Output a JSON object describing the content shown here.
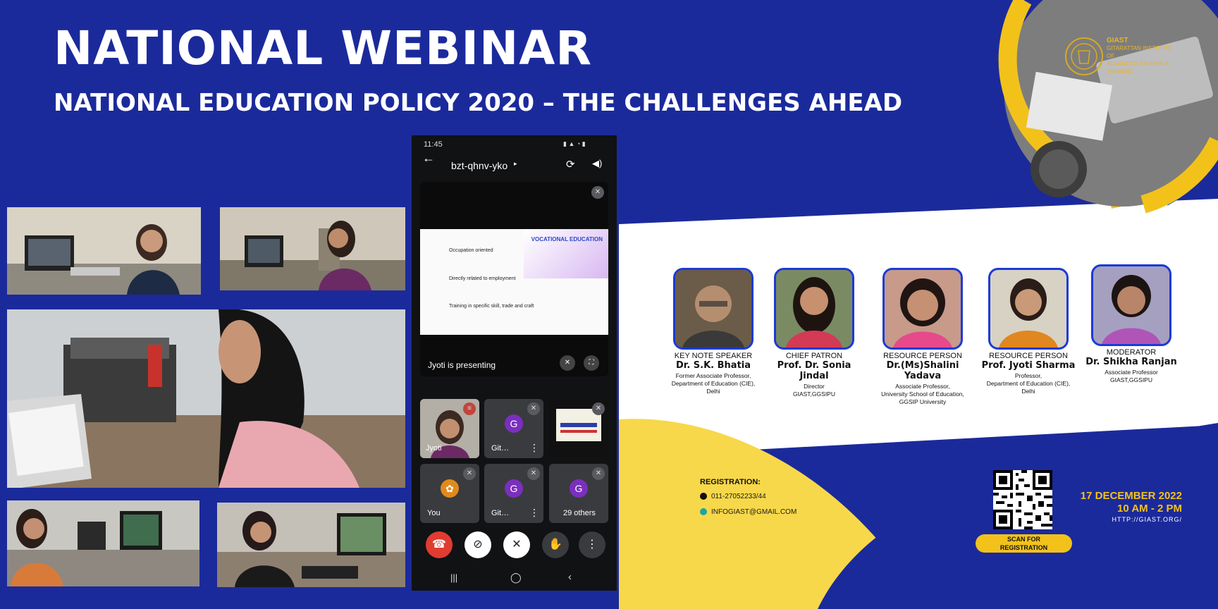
{
  "header": {
    "title": "NATIONAL WEBINAR",
    "subtitle": "NATIONAL EDUCATION POLICY 2020 – THE CHALLENGES AHEAD"
  },
  "logo": {
    "name": "GIAST",
    "line1": "GITARATTAN INSTITUTE OF",
    "line2": "ADVANCED STUDIES &",
    "line3": "TRAINING"
  },
  "phone": {
    "status_time": "11:45",
    "meeting_code": "bzt-qhnv-yko",
    "slide_title": "VOCATIONAL EDUCATION",
    "slide_bullets": [
      "Occupation oriented",
      "Directly related to employment",
      "Training in specific skill, trade and craft"
    ],
    "presenting": "Jyoti is presenting",
    "tiles": [
      {
        "name": "Jyoti"
      },
      {
        "name": "Git…",
        "initial": "G"
      },
      {
        "name": ""
      },
      {
        "name": "You"
      },
      {
        "name": "Git…",
        "initial": "G"
      },
      {
        "name": "29 others",
        "initial": "G"
      }
    ]
  },
  "speakers": [
    {
      "role": "KEY NOTE SPEAKER",
      "name": "Dr. S.K. Bhatia",
      "desc": [
        "Former Associate Professor,",
        "Department of Education (CIE),",
        "Delhi"
      ]
    },
    {
      "role": "CHIEF PATRON",
      "name": "Prof. Dr. Sonia Jindal",
      "desc": [
        "Director",
        "GIAST,GGSIPU"
      ]
    },
    {
      "role": "RESOURCE PERSON",
      "name": "Dr.(Ms)Shalini Yadava",
      "desc": [
        "Associate Professor,",
        "University School of Education,",
        "GGSIP University"
      ]
    },
    {
      "role": "RESOURCE PERSON",
      "name": "Prof. Jyoti Sharma",
      "desc": [
        "Professor,",
        "Department of Education (CIE),",
        "Delhi"
      ]
    },
    {
      "role": "MODERATOR",
      "name": "Dr. Shikha Ranjan",
      "desc": [
        "Associate Professor",
        "GIAST,GGSIPU"
      ]
    }
  ],
  "registration": {
    "heading": "REGISTRATION:",
    "phone": "011-27052233/44",
    "email": "INFOGIAST@GMAIL.COM",
    "scan_label_1": "SCAN FOR",
    "scan_label_2": "REGISTRATION"
  },
  "event": {
    "date": "17 DECEMBER 2022",
    "time": "10 AM - 2 PM",
    "url": "HTTP://GIAST.ORG/"
  },
  "colors": {
    "navy": "#1b2a9b",
    "yellow": "#f2c21b",
    "bright_blue": "#1b3ad6"
  }
}
